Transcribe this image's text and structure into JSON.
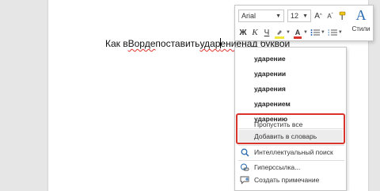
{
  "document": {
    "sentence_before": "Как в ",
    "word_vorde": "Ворде",
    "sentence_mid": " поставить ",
    "word_udarenie_a": "удар",
    "word_udarenie_b": "ение",
    "sentence_after": " над буквой"
  },
  "mini_toolbar": {
    "font_name": "Arial",
    "font_size": "12",
    "grow_font": "A",
    "shrink_font": "A",
    "bold": "Ж",
    "italic": "К",
    "underline": "Ч",
    "font_color_glyph": "A",
    "styles_label": "Стили",
    "styles_glyph": "A",
    "highlight_color": "#f0e63c",
    "font_color": "#d9342b"
  },
  "context_menu": {
    "suggestions": [
      "ударение",
      "ударении",
      "ударения",
      "ударением",
      "ударению"
    ],
    "skip_all": "Пропустить все",
    "add_to_dictionary": "Добавить в словарь",
    "smart_lookup": "Интеллектуальный поиск",
    "hyperlink": "Гиперссылка...",
    "new_comment": "Создать примечание"
  },
  "colors": {
    "highlight_box": "#d9342b",
    "accent": "#2b6cb0"
  }
}
